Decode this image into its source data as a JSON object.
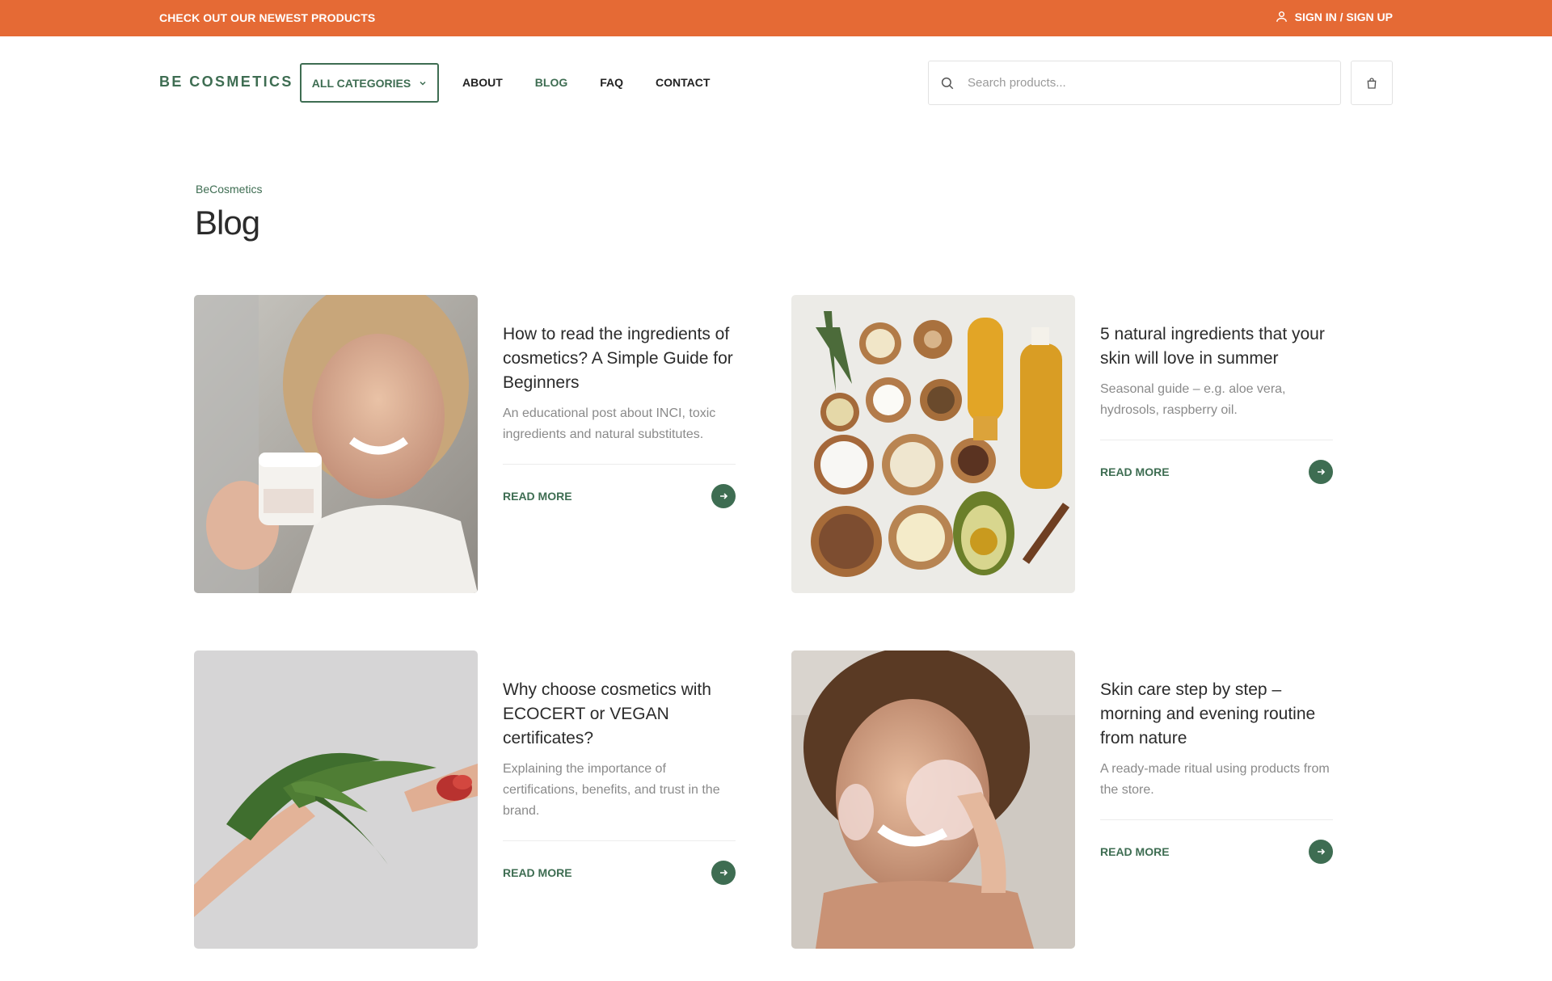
{
  "topbar": {
    "promo": "CHECK OUT OUR NEWEST PRODUCTS",
    "signin": "SIGN IN / SIGN UP"
  },
  "header": {
    "logo": "BE COSMETICS",
    "categories_label": "ALL CATEGORIES",
    "nav": [
      {
        "label": "ABOUT",
        "active": false
      },
      {
        "label": "BLOG",
        "active": true
      },
      {
        "label": "FAQ",
        "active": false
      },
      {
        "label": "CONTACT",
        "active": false
      }
    ],
    "search_placeholder": "Search products..."
  },
  "page": {
    "breadcrumb": "BeCosmetics",
    "title": "Blog"
  },
  "posts": [
    {
      "title": "How to read the ingredients of cosmetics? A Simple Guide for Beginners",
      "excerpt": "An educational post about INCI, toxic ingredients and natural substitutes.",
      "cta": "READ MORE",
      "image": "woman-holding-cream-jar"
    },
    {
      "title": "5 natural ingredients that your skin will love in summer",
      "excerpt": "Seasonal guide – e.g. aloe vera, hydrosols, raspberry oil.",
      "cta": "READ MORE",
      "image": "natural-ingredients-flatlay"
    },
    {
      "title": "Why choose cosmetics with ECOCERT or VEGAN certificates?",
      "excerpt": "Explaining the importance of certifications, benefits, and trust in the brand.",
      "cta": "READ MORE",
      "image": "hands-with-tulip"
    },
    {
      "title": "Skin care step by step – morning and evening routine from nature",
      "excerpt": "A ready-made ritual using products from the store.",
      "cta": "READ MORE",
      "image": "woman-applying-face-mask"
    }
  ],
  "colors": {
    "accent_orange": "#e56a35",
    "brand_green": "#3e6d52"
  }
}
